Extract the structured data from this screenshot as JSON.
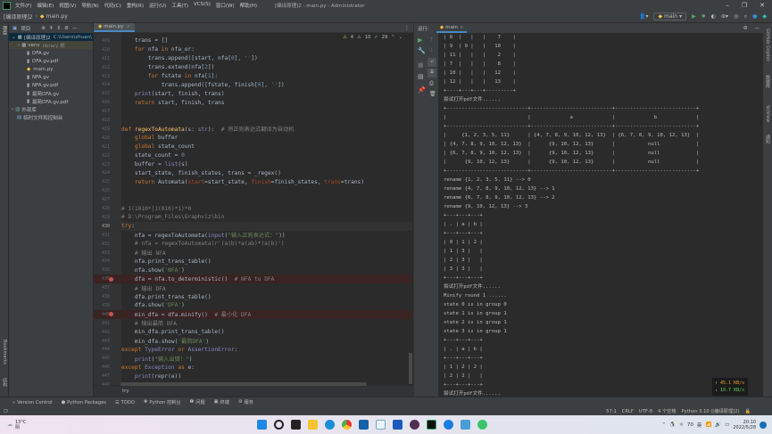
{
  "window": {
    "title": "[编译原理]2 - main.py - Administrator",
    "menu": [
      "文件(F)",
      "编辑(E)",
      "视图(V)",
      "导航(N)",
      "代码(C)",
      "重构(R)",
      "运行(U)",
      "工具(T)",
      "VCS(S)",
      "窗口(W)",
      "帮助(H)"
    ]
  },
  "breadcrumb": {
    "project": "[编译原理]2",
    "file": "main.py"
  },
  "toolbar": {
    "run_config": "main"
  },
  "left_stripe": {
    "project": "项目",
    "bookmarks": "Bookmarks",
    "structure": "结构"
  },
  "right_stripe": [
    "GitHub Copilot",
    "数据库",
    "SciView",
    "通知"
  ],
  "project_panel": {
    "title": "项目",
    "root": {
      "name": "[编译原理]2",
      "path": "C:\\Users\\zhuan\\"
    },
    "venv": {
      "name": "venv",
      "tag": "library 根"
    },
    "files": [
      "DFA.gv",
      "DFA.gv.pdf",
      "main.py",
      "NFA.gv",
      "NFA.gv.pdf",
      "最简DFA.gv",
      "最简DFA.gv.pdf"
    ],
    "external": "外部库",
    "scratches": "临时文件和控制台"
  },
  "editor": {
    "tab": "main.py",
    "inspections": {
      "warnings": "4",
      "weak_warnings": "10",
      "ok": "29"
    },
    "breadcrumb": "try",
    "lines": [
      {
        "n": "409",
        "t": [
          [
            "p",
            "    trans = []"
          ]
        ]
      },
      {
        "n": "410",
        "t": [
          [
            "k",
            "    for "
          ],
          [
            "p",
            "nfa "
          ],
          [
            "k",
            "in "
          ],
          [
            "p",
            "nfa_or:"
          ]
        ]
      },
      {
        "n": "411",
        "t": [
          [
            "p",
            "        trans.append([start, nfa["
          ],
          [
            "n",
            "0"
          ],
          [
            "p",
            "], "
          ],
          [
            "s",
            "''"
          ],
          [
            "p",
            "])"
          ]
        ]
      },
      {
        "n": "412",
        "t": [
          [
            "p",
            "        trans.extend(nfa["
          ],
          [
            "n",
            "2"
          ],
          [
            "p",
            "])"
          ]
        ]
      },
      {
        "n": "413",
        "t": [
          [
            "k",
            "        for "
          ],
          [
            "p",
            "fstate "
          ],
          [
            "k",
            "in "
          ],
          [
            "p",
            "nfa["
          ],
          [
            "n",
            "1"
          ],
          [
            "p",
            "]:"
          ]
        ]
      },
      {
        "n": "414",
        "t": [
          [
            "p",
            "            trans.append([fstate, finish["
          ],
          [
            "n",
            "0"
          ],
          [
            "p",
            "], "
          ],
          [
            "s",
            "''"
          ],
          [
            "p",
            "])"
          ]
        ]
      },
      {
        "n": "415",
        "t": [
          [
            "f",
            "    print"
          ],
          [
            "p",
            "(start, finish, trans)"
          ]
        ]
      },
      {
        "n": "416",
        "t": [
          [
            "k",
            "    return "
          ],
          [
            "p",
            "start, finish, trans"
          ]
        ]
      },
      {
        "n": "417",
        "t": []
      },
      {
        "n": "418",
        "t": []
      },
      {
        "n": "419",
        "t": [
          [
            "k",
            "def "
          ],
          [
            "d",
            "regexToAutomata"
          ],
          [
            "p",
            "(s: "
          ],
          [
            "f",
            "str"
          ],
          [
            "p",
            "):  "
          ],
          [
            "c",
            "# 将正则表达式翻译为自动机"
          ]
        ]
      },
      {
        "n": "420",
        "t": [
          [
            "k",
            "    global "
          ],
          [
            "p",
            "buffer"
          ]
        ]
      },
      {
        "n": "421",
        "t": [
          [
            "k",
            "    global "
          ],
          [
            "p",
            "state_count"
          ]
        ]
      },
      {
        "n": "422",
        "t": [
          [
            "p",
            "    state_count = "
          ],
          [
            "n",
            "0"
          ]
        ]
      },
      {
        "n": "423",
        "t": [
          [
            "p",
            "    buffer = "
          ],
          [
            "f",
            "list"
          ],
          [
            "p",
            "(s)"
          ]
        ]
      },
      {
        "n": "424",
        "t": [
          [
            "p",
            "    start_state, finish_states, trans = _regex()"
          ]
        ]
      },
      {
        "n": "425",
        "t": [
          [
            "k",
            "    return "
          ],
          [
            "p",
            "Automata("
          ],
          [
            "a",
            "start"
          ],
          [
            "p",
            "=start_state, "
          ],
          [
            "a",
            "finish"
          ],
          [
            "p",
            "=finish_states, "
          ],
          [
            "a",
            "trans"
          ],
          [
            "p",
            "=trans)"
          ]
        ]
      },
      {
        "n": "426",
        "t": []
      },
      {
        "n": "427",
        "t": []
      },
      {
        "n": "428",
        "t": [
          [
            "c",
            "# 1(1010*|1(010)*1)*0"
          ]
        ]
      },
      {
        "n": "429",
        "t": [
          [
            "c",
            "# D:\\Program_Files\\Graphviz\\bin"
          ]
        ]
      },
      {
        "n": "430",
        "t": [
          [
            "k",
            "try"
          ],
          [
            "p",
            ":"
          ]
        ],
        "current": true
      },
      {
        "n": "431",
        "t": [
          [
            "p",
            "    nfa = regexToAutomata("
          ],
          [
            "f",
            "input"
          ],
          [
            "p",
            "("
          ],
          [
            "s",
            "\"输入正则表达式：\""
          ],
          [
            "p",
            "))"
          ]
        ]
      },
      {
        "n": "432",
        "t": [
          [
            "c",
            "    # nfa = regexToAutomata(r'(a|b)*a(ab)*(a|b)')"
          ]
        ]
      },
      {
        "n": "433",
        "t": [
          [
            "c",
            "    # 输出 NFA"
          ]
        ]
      },
      {
        "n": "434",
        "t": [
          [
            "p",
            "    nfa.print_trans_table()"
          ]
        ]
      },
      {
        "n": "435",
        "t": [
          [
            "p",
            "    nfa.show("
          ],
          [
            "s",
            "'NFA'"
          ],
          [
            "p",
            ")"
          ]
        ]
      },
      {
        "n": "436",
        "t": [
          [
            "p",
            "    dfa = nfa.to_deterministic()  "
          ],
          [
            "c",
            "# NFA to DFA"
          ]
        ],
        "breakpoint": true
      },
      {
        "n": "437",
        "t": [
          [
            "c",
            "    # 输出 DFA"
          ]
        ]
      },
      {
        "n": "438",
        "t": [
          [
            "p",
            "    dfa.print_trans_table()"
          ]
        ]
      },
      {
        "n": "439",
        "t": [
          [
            "p",
            "    dfa.show("
          ],
          [
            "s",
            "'DFA'"
          ],
          [
            "p",
            ")"
          ]
        ]
      },
      {
        "n": "440",
        "t": [
          [
            "p",
            "    min_dfa = dfa.minify()  "
          ],
          [
            "c",
            "# 最小化 DFA"
          ]
        ],
        "breakpoint": true
      },
      {
        "n": "441",
        "t": [
          [
            "c",
            "    # 输出最简 DFA"
          ]
        ]
      },
      {
        "n": "442",
        "t": [
          [
            "p",
            "    min_dfa.print_trans_table()"
          ]
        ]
      },
      {
        "n": "443",
        "t": [
          [
            "p",
            "    min_dfa.show("
          ],
          [
            "s",
            "'最简DFA'"
          ],
          [
            "p",
            ")"
          ]
        ]
      },
      {
        "n": "444",
        "t": [
          [
            "k",
            "except "
          ],
          [
            "f",
            "TypeError "
          ],
          [
            "k",
            "or "
          ],
          [
            "f",
            "AssertionError"
          ],
          [
            "p",
            ":"
          ]
        ]
      },
      {
        "n": "445",
        "t": [
          [
            "f",
            "    print"
          ],
          [
            "p",
            "("
          ],
          [
            "s",
            "\"输入出错！\""
          ],
          [
            "p",
            ")"
          ]
        ]
      },
      {
        "n": "446",
        "t": [
          [
            "k",
            "except "
          ],
          [
            "f",
            "Exception "
          ],
          [
            "k",
            "as "
          ],
          [
            "p",
            "e:"
          ]
        ]
      },
      {
        "n": "447",
        "t": [
          [
            "f",
            "    print"
          ],
          [
            "p",
            "(repr(e))"
          ]
        ]
      },
      {
        "n": "448",
        "t": []
      }
    ]
  },
  "run_panel": {
    "label": "运行:",
    "tab": "main",
    "console": [
      "| 8  |   |   |    7    |",
      "| 9  | 9 |   |   10    |",
      "| 11 |   |   |    2    |",
      "| 7  |   |   |    8    |",
      "| 10 |   |   |   12    |",
      "| 12 |   |   |   13    |",
      "+----+---+---+---------+",
      "尝试打开pdf文件......",
      "+---------------------------+---------------------------+---------------------------+",
      "|                           |             a             |             b             |",
      "+---------------------------+---------------------------+---------------------------+",
      "|     {1, 2, 3, 5, 11}      | {4, 7, 8, 9, 10, 12, 13}  | {6, 7, 8, 9, 10, 12, 13}  |",
      "| {4, 7, 8, 9, 10, 12, 13}  |      {9, 10, 12, 13}      |           null            |",
      "| {6, 7, 8, 9, 10, 12, 13}  |      {9, 10, 12, 13}      |           null            |",
      "|      {9, 10, 12, 13}      |      {9, 10, 12, 13}      |           null            |",
      "+---------------------------+---------------------------+---------------------------+",
      "rename {1, 2, 3, 5, 11} --> 0",
      "rename {4, 7, 8, 9, 10, 12, 13} --> 1",
      "rename {6, 7, 8, 9, 10, 12, 13} --> 2",
      "rename {9, 10, 12, 13} --> 3",
      "+---+---+---+",
      "| . | a | b |",
      "+---+---+---+",
      "| 0 | 1 | 2 |",
      "| 1 | 3 |   |",
      "| 2 | 3 |   |",
      "| 3 | 3 |   |",
      "+---+---+---+",
      "尝试打开pdf文件......",
      "Minify round 1 ......",
      "state 0 is in group 0",
      "state 1 is in group 1",
      "state 2 is in group 1",
      "state 3 is in group 1",
      "+---+---+---+",
      "| . | a | b |",
      "+---+---+---+",
      "| 1 | 2 | 2 |",
      "| 2 | 2 |   |",
      "+---+---+---+",
      "尝试打开pdf文件......"
    ]
  },
  "net_speed": {
    "up": "↑ 45.1 KB/s",
    "down": "↓ 10.7 KB/s",
    "up_color": "#f0a030",
    "down_color": "#60d060"
  },
  "bottom_tools": [
    "Version Control",
    "Python Packages",
    "TODO",
    "Python 控制台",
    "问题",
    "终端",
    "服务"
  ],
  "status_bar": {
    "position": "57:1",
    "line_sep": "CRLF",
    "encoding": "UTF-8",
    "indent": "4 个空格",
    "interpreter": "Python 3.10 ([编译原理]2)"
  },
  "taskbar": {
    "weather_temp": "13°C",
    "weather_desc": "阴",
    "tray_num": "70",
    "ime": "英",
    "time": "20:10",
    "date": "2022/5/28"
  },
  "colors": {
    "keyword": "#cc7832",
    "string": "#6a8759",
    "comment": "#808080",
    "number": "#6897bb",
    "breakpoint": "#c75450",
    "selection": "#0d293e"
  }
}
